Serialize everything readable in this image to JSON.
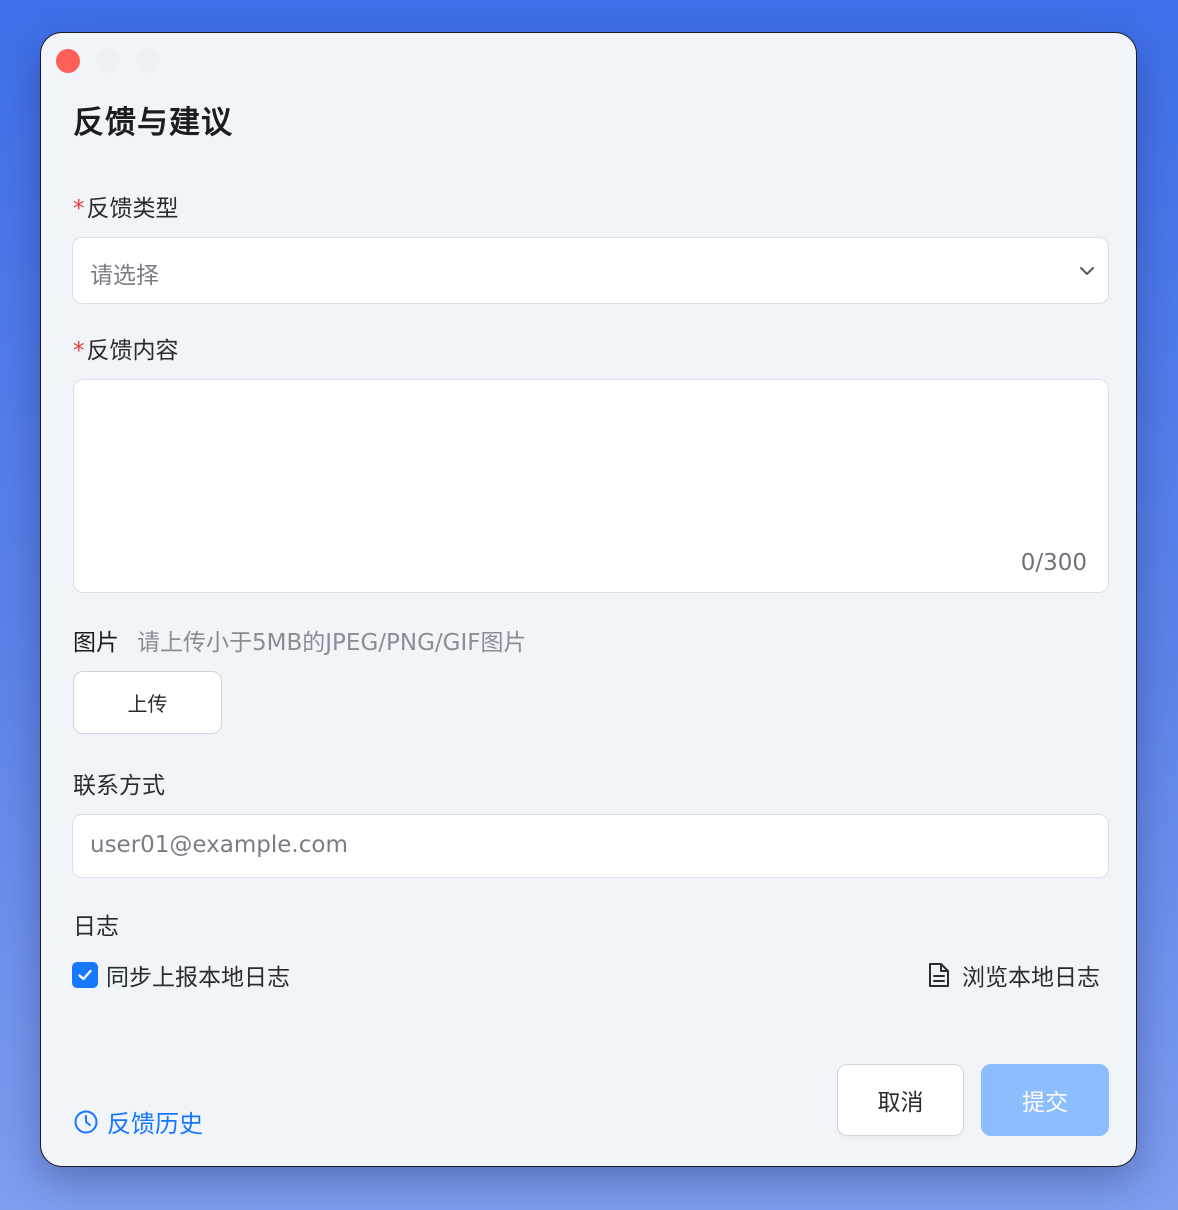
{
  "dialog": {
    "title": "反馈与建议"
  },
  "feedback_type": {
    "required_mark": "*",
    "label": "反馈类型",
    "placeholder": "请选择"
  },
  "feedback_content": {
    "required_mark": "*",
    "label": "反馈内容",
    "value": "",
    "counter": "0/300"
  },
  "image": {
    "label": "图片",
    "hint": "请上传小于5MB的JPEG/PNG/GIF图片",
    "upload_label": "上传"
  },
  "contact": {
    "label": "联系方式",
    "value": "user01@example.com"
  },
  "log": {
    "label": "日志",
    "sync_label": "同步上报本地日志",
    "sync_checked": true,
    "browse_label": "浏览本地日志"
  },
  "footer": {
    "history_label": "反馈历史",
    "cancel_label": "取消",
    "submit_label": "提交"
  },
  "colors": {
    "accent": "#1677ff",
    "submit_disabled": "#8cbdfc",
    "required": "#e23b3b",
    "close_dot": "#fe5f57"
  },
  "icons": {
    "select_arrow": "chevron-down-icon",
    "checkbox": "check-icon",
    "browse": "document-icon",
    "history": "clock-icon"
  }
}
